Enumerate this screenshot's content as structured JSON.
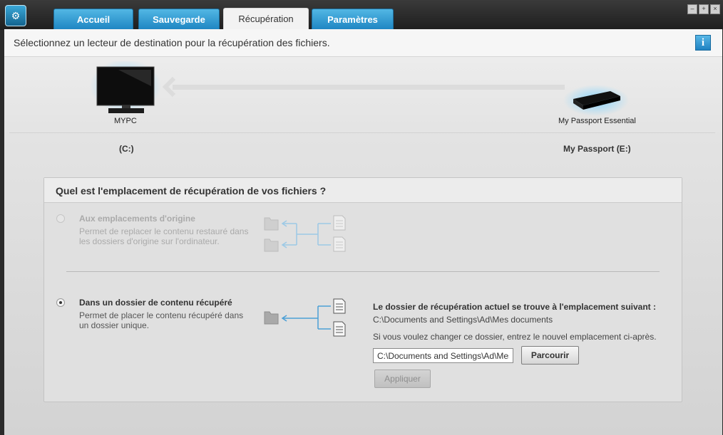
{
  "tabs": [
    {
      "label": "Accueil"
    },
    {
      "label": "Sauvegarde"
    },
    {
      "label": "Récupération"
    },
    {
      "label": "Paramètres"
    }
  ],
  "header": {
    "instruction": "Sélectionnez un lecteur de destination pour la récupération des fichiers.",
    "info_icon": "i"
  },
  "devices": {
    "computer": {
      "name": "MYPC",
      "drive": "(C:)"
    },
    "external": {
      "name": "My Passport Essential",
      "drive": "My Passport (E:)"
    }
  },
  "location_panel": {
    "title": "Quel est l'emplacement de récupération de vos fichiers ?",
    "option_original": {
      "title": "Aux emplacements d'origine",
      "desc_line1": "Permet de replacer le contenu restauré dans",
      "desc_line2": "les dossiers d'origine sur l'ordinateur.",
      "selected": false,
      "enabled": false
    },
    "option_folder": {
      "title": "Dans un dossier de contenu récupéré",
      "desc_line1": "Permet de placer le contenu récupéré dans",
      "desc_line2": "un dossier unique.",
      "selected": true,
      "enabled": true
    },
    "current_folder_label": "Le dossier de récupération actuel se trouve à l'emplacement suivant :",
    "current_folder_path": "C:\\Documents and Settings\\Ad\\Mes documents",
    "change_hint": "Si vous voulez changer ce dossier, entrez le nouvel emplacement ci-après.",
    "path_input_value": "C:\\Documents and Settings\\Ad\\Mes documents",
    "browse_label": "Parcourir",
    "apply_label": "Appliquer"
  },
  "colors": {
    "accent_blue": "#2a93d1",
    "tab_active_bg": "#f2f2f2",
    "content_bg": "#e3e3e3"
  }
}
